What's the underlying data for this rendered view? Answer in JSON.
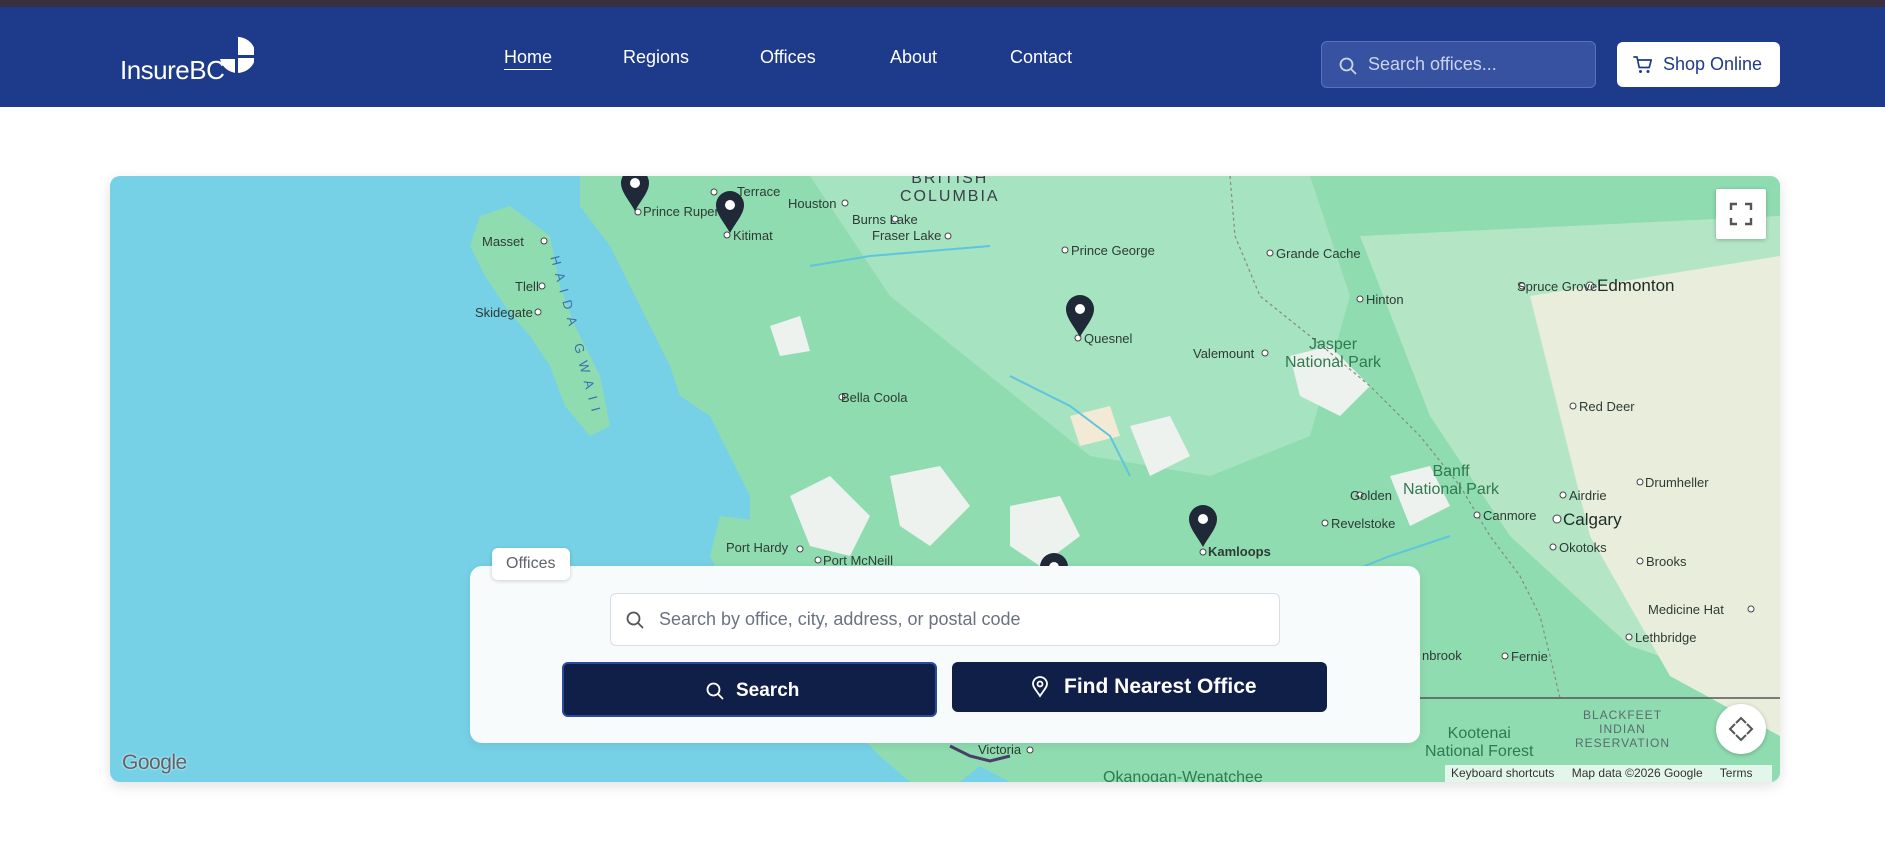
{
  "header": {
    "logo_text": "InsureBC",
    "nav": [
      {
        "label": "Home",
        "active": true
      },
      {
        "label": "Regions",
        "active": false
      },
      {
        "label": "Offices",
        "active": false
      },
      {
        "label": "About",
        "active": false
      },
      {
        "label": "Contact",
        "active": false
      }
    ],
    "search_placeholder": "Search offices...",
    "shop_label": "Shop Online",
    "colors": {
      "header_bg": "#1e3a8a",
      "button_dark": "#0f1f47"
    }
  },
  "map": {
    "labels": {
      "british_columbia": "BRITISH\nCOLUMBIA",
      "haida_gwaii": "HAIDA GWAII",
      "masset": "Masset",
      "tlell": "Tlell",
      "skidegate": "Skidegate",
      "prince_rupert": "Prince Ruper",
      "terrace": "Terrace",
      "kitimat": "Kitimat",
      "houston": "Houston",
      "burns_lake": "Burns Lake",
      "fraser_lake": "Fraser Lake",
      "prince_george": "Prince George",
      "grande_cache": "Grande Cache",
      "hinton": "Hinton",
      "spruce_grove": "Spruce Grove",
      "edmonton": "Edmonton",
      "quesnel": "Quesnel",
      "valemount": "Valemount",
      "jasper": "Jasper\nNational Park",
      "red_deer": "Red Deer",
      "bella_coola": "Bella Coola",
      "banff": "Banff\nNational Park",
      "drumheller": "Drumheller",
      "airdrie": "Airdrie",
      "golden": "Golden",
      "canmore": "Canmore",
      "calgary": "Calgary",
      "revelstoke": "Revelstoke",
      "okotoks": "Okotoks",
      "brooks": "Brooks",
      "port_hardy": "Port Hardy",
      "port_mcneill": "Port McNeill",
      "kamloops": "Kamloops",
      "medicine_hat": "Medicine Hat",
      "lethbridge": "Lethbridge",
      "cranbrook": "nbrook",
      "fernie": "Fernie",
      "blackfeet": "BLACKFEET\nINDIAN\nRESERVATION",
      "kootenai": "Kootenai\nNational Forest",
      "victoria": "Victoria",
      "okanogan": "Okanogan-Wenatchee"
    },
    "google_logo": "Google",
    "attribution": {
      "shortcuts": "Keyboard shortcuts",
      "data": "Map data ©2026 Google",
      "terms": "Terms"
    }
  },
  "office_panel": {
    "tab_label": "Offices",
    "search_placeholder": "Search by office, city, address, or postal code",
    "search_button": "Search",
    "nearest_button": "Find Nearest Office"
  }
}
